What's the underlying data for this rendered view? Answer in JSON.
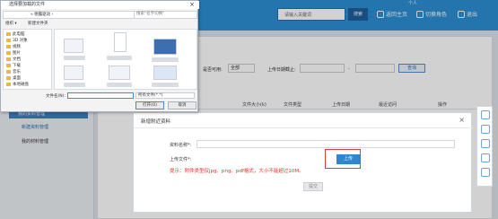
{
  "header": {
    "search_placeholder": "请输入关键词",
    "search_button": "搜索",
    "links": [
      "返回主页",
      "切换角色",
      "退出"
    ],
    "account": "个人"
  },
  "sidebar": {
    "section": "我的资料管理",
    "items": [
      "新建资料管理",
      "我的材料管理"
    ]
  },
  "filters": {
    "status_label": "是否可用:",
    "status_value": "全部",
    "date_label": "上传日期截止:",
    "date_sep": "-",
    "query_button": "查询"
  },
  "table": {
    "headers": [
      "文件大小(k)",
      "文件类型",
      "上传日期",
      "最近访问",
      "操作"
    ]
  },
  "modal": {
    "title": "新增附近资料",
    "close": "×",
    "name_label": "资料名称*:",
    "file_label": "上传文件*:",
    "upload_button": "上传",
    "hint": "提示：附件类型仅jpg、png、pdf格式，大小不能超过10M。",
    "submit_button": "提交"
  },
  "file_dialog": {
    "title": "选择要加载的文件",
    "close": "×",
    "path": "« 德露驱动 ›",
    "search_placeholder": "搜索\"名字切换\"",
    "toolbar_left": "组织 ▾",
    "toolbar_new": "新建文件夹",
    "tree": [
      "此电脑",
      "3D 对象",
      "视频",
      "图片",
      "文档",
      "下载",
      "音乐",
      "桌面",
      "本地磁盘"
    ],
    "filename_label": "文件名(N):",
    "filetype": "所有文件(*.*)",
    "open_button": "打开(O)",
    "cancel_button": "取消"
  },
  "accent": "#2d8fd5",
  "highlight": "#e23b3b"
}
